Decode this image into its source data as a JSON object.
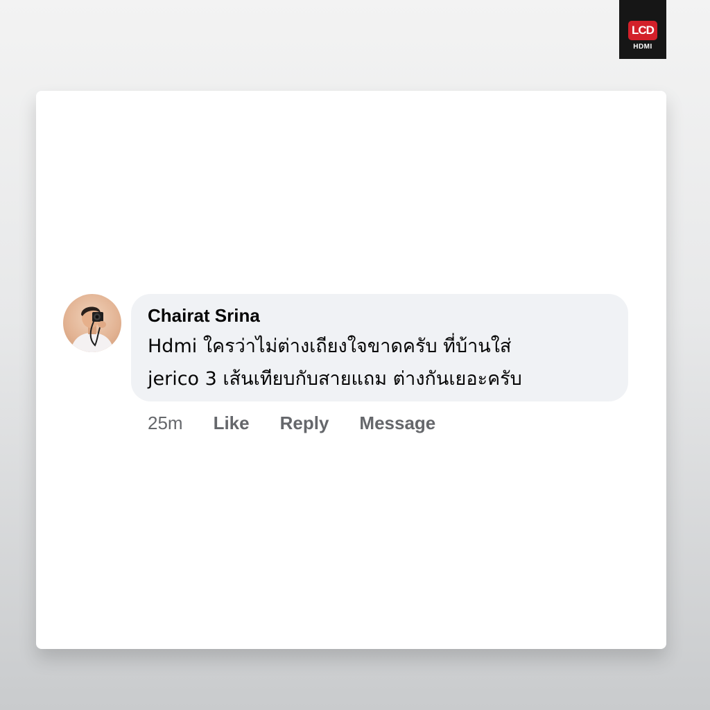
{
  "logo": {
    "mark_text": "LCD",
    "sub_text": "HDMI",
    "brand_color": "#d3202a"
  },
  "comment": {
    "author": "Chairat Srina",
    "text_line_1": "Hdmi ใครว่าไม่ต่างเถียงใจขาดครับ ที่บ้านใส่",
    "text_line_2": "jerico 3 เส้นเทียบกับสายแถม ต่างกันเยอะครับ",
    "avatar_icon": "user-avatar-icon"
  },
  "actions": {
    "time": "25m",
    "like_label": "Like",
    "reply_label": "Reply",
    "message_label": "Message"
  }
}
